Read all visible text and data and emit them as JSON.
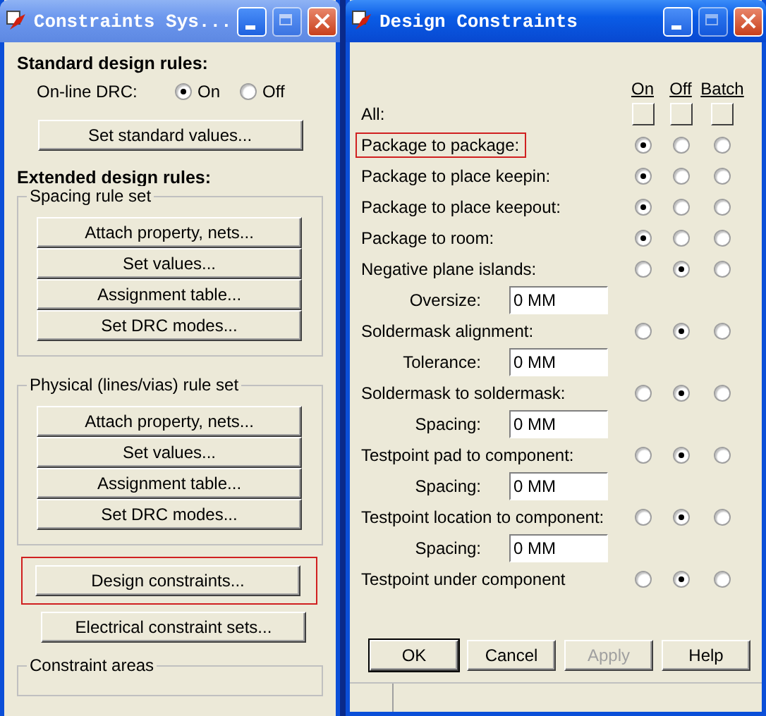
{
  "left_window": {
    "title": "Constraints Sys...",
    "standard": {
      "heading": "Standard design rules:",
      "drc_label": "On-line DRC:",
      "options": [
        {
          "label": "On",
          "selected": true
        },
        {
          "label": "Off",
          "selected": false
        }
      ],
      "button": "Set standard values..."
    },
    "extended_heading": "Extended design rules:",
    "groups": [
      {
        "title": "Spacing rule set",
        "buttons": [
          "Attach property, nets...",
          "Set values...",
          "Assignment table...",
          "Set DRC modes..."
        ]
      },
      {
        "title": "Physical (lines/vias) rule set",
        "buttons": [
          "Attach property, nets...",
          "Set values...",
          "Assignment table...",
          "Set DRC modes..."
        ]
      }
    ],
    "buttons": [
      {
        "label": "Design constraints...",
        "highlighted": true
      },
      {
        "label": "Electrical constraint sets...",
        "highlighted": false
      }
    ],
    "cut_group_title": "Constraint areas"
  },
  "right_window": {
    "title": "Design Constraints",
    "columns": [
      "On",
      "Off",
      "Batch"
    ],
    "all_label": "All:",
    "rows": [
      {
        "kind": "rule",
        "label": "Package to package:",
        "highlighted": true,
        "options": [
          {
            "selected": true
          },
          {
            "selected": false
          },
          {
            "selected": false
          }
        ]
      },
      {
        "kind": "rule",
        "label": "Package to place keepin:",
        "highlighted": false,
        "options": [
          {
            "selected": true
          },
          {
            "selected": false
          },
          {
            "selected": false
          }
        ]
      },
      {
        "kind": "rule",
        "label": "Package to place keepout:",
        "highlighted": false,
        "options": [
          {
            "selected": true
          },
          {
            "selected": false
          },
          {
            "selected": false
          }
        ]
      },
      {
        "kind": "rule",
        "label": "Package to room:",
        "highlighted": false,
        "options": [
          {
            "selected": true
          },
          {
            "selected": false
          },
          {
            "selected": false
          }
        ]
      },
      {
        "kind": "rule",
        "label": "Negative plane islands:",
        "highlighted": false,
        "options": [
          {
            "selected": false
          },
          {
            "selected": true
          },
          {
            "selected": false
          }
        ]
      },
      {
        "kind": "value",
        "label": "Oversize:",
        "value": "0 MM"
      },
      {
        "kind": "rule",
        "label": "Soldermask alignment:",
        "highlighted": false,
        "options": [
          {
            "selected": false
          },
          {
            "selected": true
          },
          {
            "selected": false
          }
        ]
      },
      {
        "kind": "value",
        "label": "Tolerance:",
        "value": "0 MM"
      },
      {
        "kind": "rule",
        "label": "Soldermask to soldermask:",
        "highlighted": false,
        "options": [
          {
            "selected": false
          },
          {
            "selected": true
          },
          {
            "selected": false
          }
        ]
      },
      {
        "kind": "value",
        "label": "Spacing:",
        "value": "0 MM"
      },
      {
        "kind": "rule",
        "label": "Testpoint pad to component:",
        "highlighted": false,
        "options": [
          {
            "selected": false
          },
          {
            "selected": true
          },
          {
            "selected": false
          }
        ]
      },
      {
        "kind": "value",
        "label": "Spacing:",
        "value": "0 MM"
      },
      {
        "kind": "rule",
        "label": "Testpoint location to component:",
        "highlighted": false,
        "options": [
          {
            "selected": false
          },
          {
            "selected": true
          },
          {
            "selected": false
          }
        ]
      },
      {
        "kind": "value",
        "label": "Spacing:",
        "value": "0 MM"
      },
      {
        "kind": "rule",
        "label": "Testpoint under component",
        "highlighted": false,
        "options": [
          {
            "selected": false
          },
          {
            "selected": true
          },
          {
            "selected": false
          }
        ]
      }
    ],
    "buttons": [
      {
        "label": "OK",
        "disabled": false,
        "default": true
      },
      {
        "label": "Cancel",
        "disabled": false,
        "default": false
      },
      {
        "label": "Apply",
        "disabled": true,
        "default": false
      },
      {
        "label": "Help",
        "disabled": false,
        "default": false
      }
    ]
  }
}
